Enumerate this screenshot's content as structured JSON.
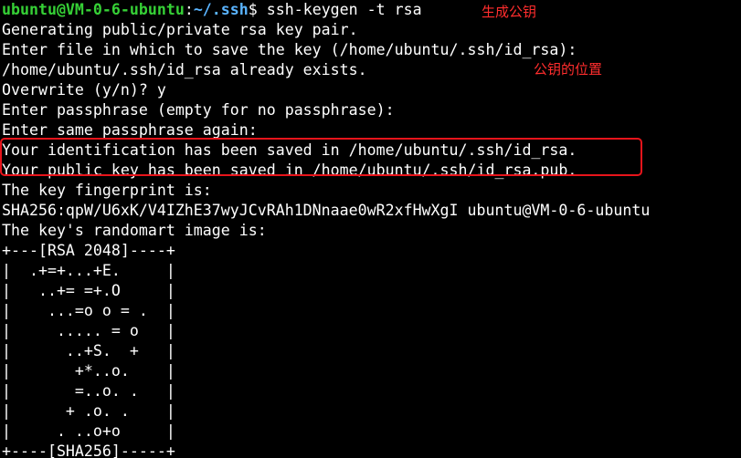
{
  "terminal": {
    "prompt": {
      "user_host": "ubuntu@VM-0-6-ubuntu",
      "separator": ":",
      "path": "~/.ssh",
      "symbol": "$ ",
      "command": "ssh-keygen -t rsa"
    },
    "output": [
      "Generating public/private rsa key pair.",
      "Enter file in which to save the key (/home/ubuntu/.ssh/id_rsa):",
      "/home/ubuntu/.ssh/id_rsa already exists.",
      "Overwrite (y/n)? y",
      "Enter passphrase (empty for no passphrase):",
      "Enter same passphrase again:",
      "Your identification has been saved in /home/ubuntu/.ssh/id_rsa.",
      "Your public key has been saved in /home/ubuntu/.ssh/id_rsa.pub.",
      "The key fingerprint is:",
      "SHA256:qpW/U6xK/V4IZhE37wyJCvRAh1DNnaae0wR2xfHwXgI ubuntu@VM-0-6-ubuntu",
      "The key's randomart image is:",
      "+---[RSA 2048]----+",
      "|  .+=+...+E.     |",
      "|   ..+= =+.O     |",
      "|    ...=o o = .  |",
      "|     ..... = o   |",
      "|      ..+S.  +   |",
      "|       +*..o.    |",
      "|       =..o. .   |",
      "|      + .o. .    |",
      "|     . ..o+o     |",
      "+----[SHA256]-----+"
    ]
  },
  "annotations": {
    "generate_key": "生成公钥",
    "key_location": "公钥的位置"
  },
  "colors": {
    "background": "#000000",
    "text": "#ffffff",
    "prompt_user": "#36d136",
    "prompt_path": "#5ab4ff",
    "annotation": "#ff2d2d",
    "highlight_border": "#e8141b"
  }
}
